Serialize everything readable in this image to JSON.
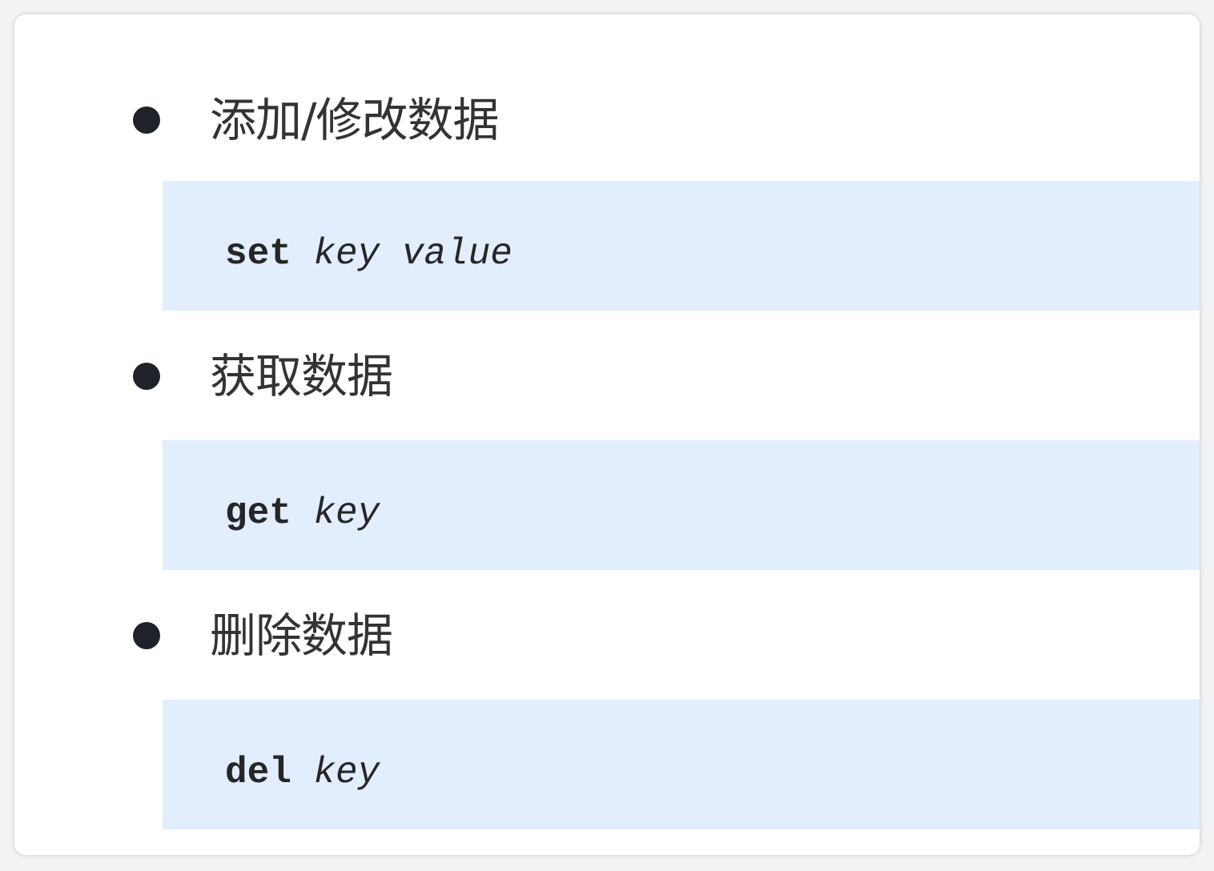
{
  "sections": [
    {
      "heading": "添加/修改数据",
      "command": "set",
      "args": "key value"
    },
    {
      "heading": "获取数据",
      "command": "get",
      "args": "key"
    },
    {
      "heading": "删除数据",
      "command": "del",
      "args": "key"
    }
  ],
  "colors": {
    "code_background": "#e2edfd",
    "bullet": "#1f2329",
    "heading_text": "#333333"
  }
}
